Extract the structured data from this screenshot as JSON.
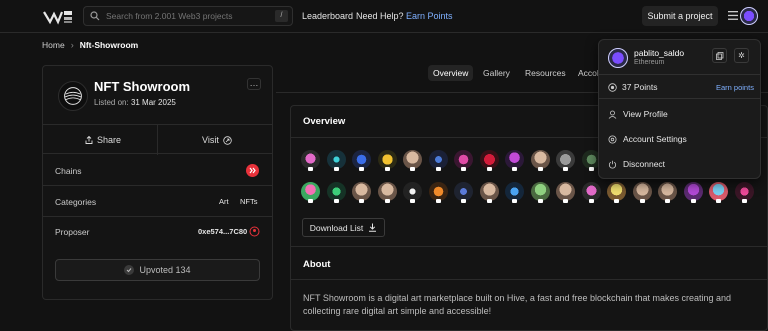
{
  "topnav": {
    "search_placeholder": "Search from 2.001 Web3 projects",
    "search_shortcut": "/",
    "links": [
      "Leaderboard",
      "Need Help?",
      "Earn Points"
    ],
    "submit_label": "Submit a project",
    "accent_color": "#7fb0ff"
  },
  "breadcrumb": {
    "home": "Home",
    "current": "Nft-Showroom"
  },
  "project": {
    "title": "NFT Showroom",
    "listed_label": "Listed on:",
    "listed_date": "31 Mar 2025",
    "share_label": "Share",
    "visit_label": "Visit",
    "chains_label": "Chains",
    "categories_label": "Categories",
    "categories": [
      "Art",
      "NFTs"
    ],
    "proposer_label": "Proposer",
    "proposer_address": "0xe574...7C80",
    "upvote_label": "Upvoted 134"
  },
  "tabs": [
    "Overview",
    "Gallery",
    "Resources",
    "Accol"
  ],
  "overview": {
    "title": "Overview",
    "download_label": "Download List",
    "about_title": "About",
    "about_text": "NFT Showroom is a digital art marketplace built on Hive, a fast and free blockchain that makes creating and collecting rare digital art simple and accessible!",
    "chain_icons": [
      "pixel-avatar-icon",
      "crosshair-icon",
      "blue-gear-icon",
      "yellow-diamond-icon",
      "face-avatar-icon",
      "blue-orb-icon",
      "pink-gem-icon",
      "red-orb-icon",
      "wizard-avatar-icon",
      "face-avatar-icon",
      "grey-pattern-icon",
      "green-tree-icon",
      "colorful-avatar-icon",
      "green-gear-icon",
      "face-avatar-icon",
      "face-avatar-icon",
      "white-star-icon",
      "orange-diamond-icon",
      "dark-gear-icon",
      "face-avatar-icon",
      "blue-ring-icon",
      "green-avatar-icon",
      "face-avatar-icon",
      "pixel-avatar-icon",
      "blonde-avatar-icon",
      "face-avatar-icon",
      "face-avatar-icon",
      "pink-avatar-icon",
      "anime-avatar-icon",
      "pink-flower-icon"
    ]
  },
  "dropdown": {
    "username": "pablito_saldo",
    "chain": "Ethereum",
    "points": "37 Points",
    "earn_points": "Earn points",
    "items": [
      "View Profile",
      "Account Settings",
      "Disconnect"
    ]
  }
}
